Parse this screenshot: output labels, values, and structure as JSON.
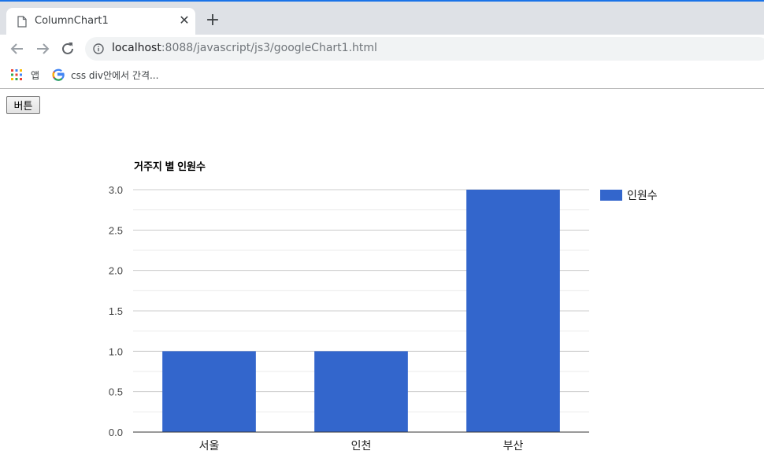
{
  "browser": {
    "tab_title": "ColumnChart1",
    "url_host": "localhost",
    "url_rest": ":8088/javascript/js3/googleChart1.html",
    "bookmarks": [
      {
        "label": "앱"
      },
      {
        "label": "css div안에서 간격..."
      }
    ]
  },
  "page": {
    "button_label": "버튼"
  },
  "colors": {
    "bar": "#3366cc",
    "accent": "#1a73e8"
  },
  "chart_data": {
    "type": "bar",
    "title": "거주지 별 인원수",
    "categories": [
      "서울",
      "인천",
      "부산"
    ],
    "series": [
      {
        "name": "인원수",
        "values": [
          1,
          1,
          3
        ]
      }
    ],
    "ylim": [
      0,
      3
    ],
    "yticks": [
      "0.0",
      "0.5",
      "1.0",
      "1.5",
      "2.0",
      "2.5",
      "3.0"
    ],
    "legend_position": "right",
    "grid": true
  }
}
